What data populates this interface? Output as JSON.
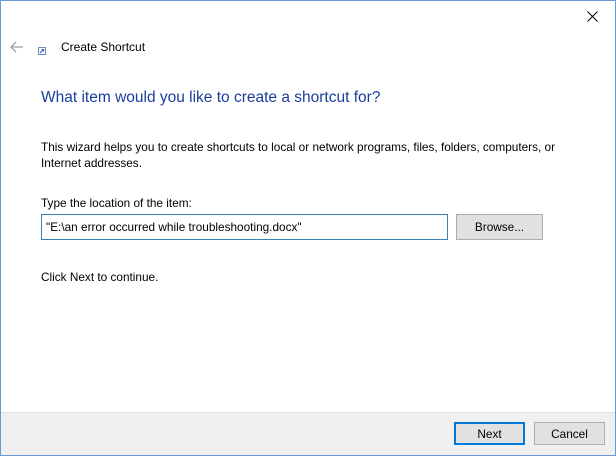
{
  "window": {
    "title": "Create Shortcut",
    "close_label": "✕"
  },
  "icons": {
    "back": "arrow-left-icon",
    "app": "shortcut-icon",
    "close": "close-icon"
  },
  "main": {
    "heading": "What item would you like to create a shortcut for?",
    "description": "This wizard helps you to create shortcuts to local or network programs, files, folders, computers, or Internet addresses.",
    "location_label": "Type the location of the item:",
    "location_value": "\"E:\\an error occurred while troubleshooting.docx\"",
    "browse_label": "Browse...",
    "continue_text": "Click Next to continue."
  },
  "footer": {
    "next_label": "Next",
    "cancel_label": "Cancel"
  },
  "colors": {
    "heading": "#1a3e9c",
    "window_border": "#6a9ad6",
    "input_border": "#3c7fb1",
    "focus_border": "#0078d7",
    "footer_bg": "#f0f0f0"
  }
}
